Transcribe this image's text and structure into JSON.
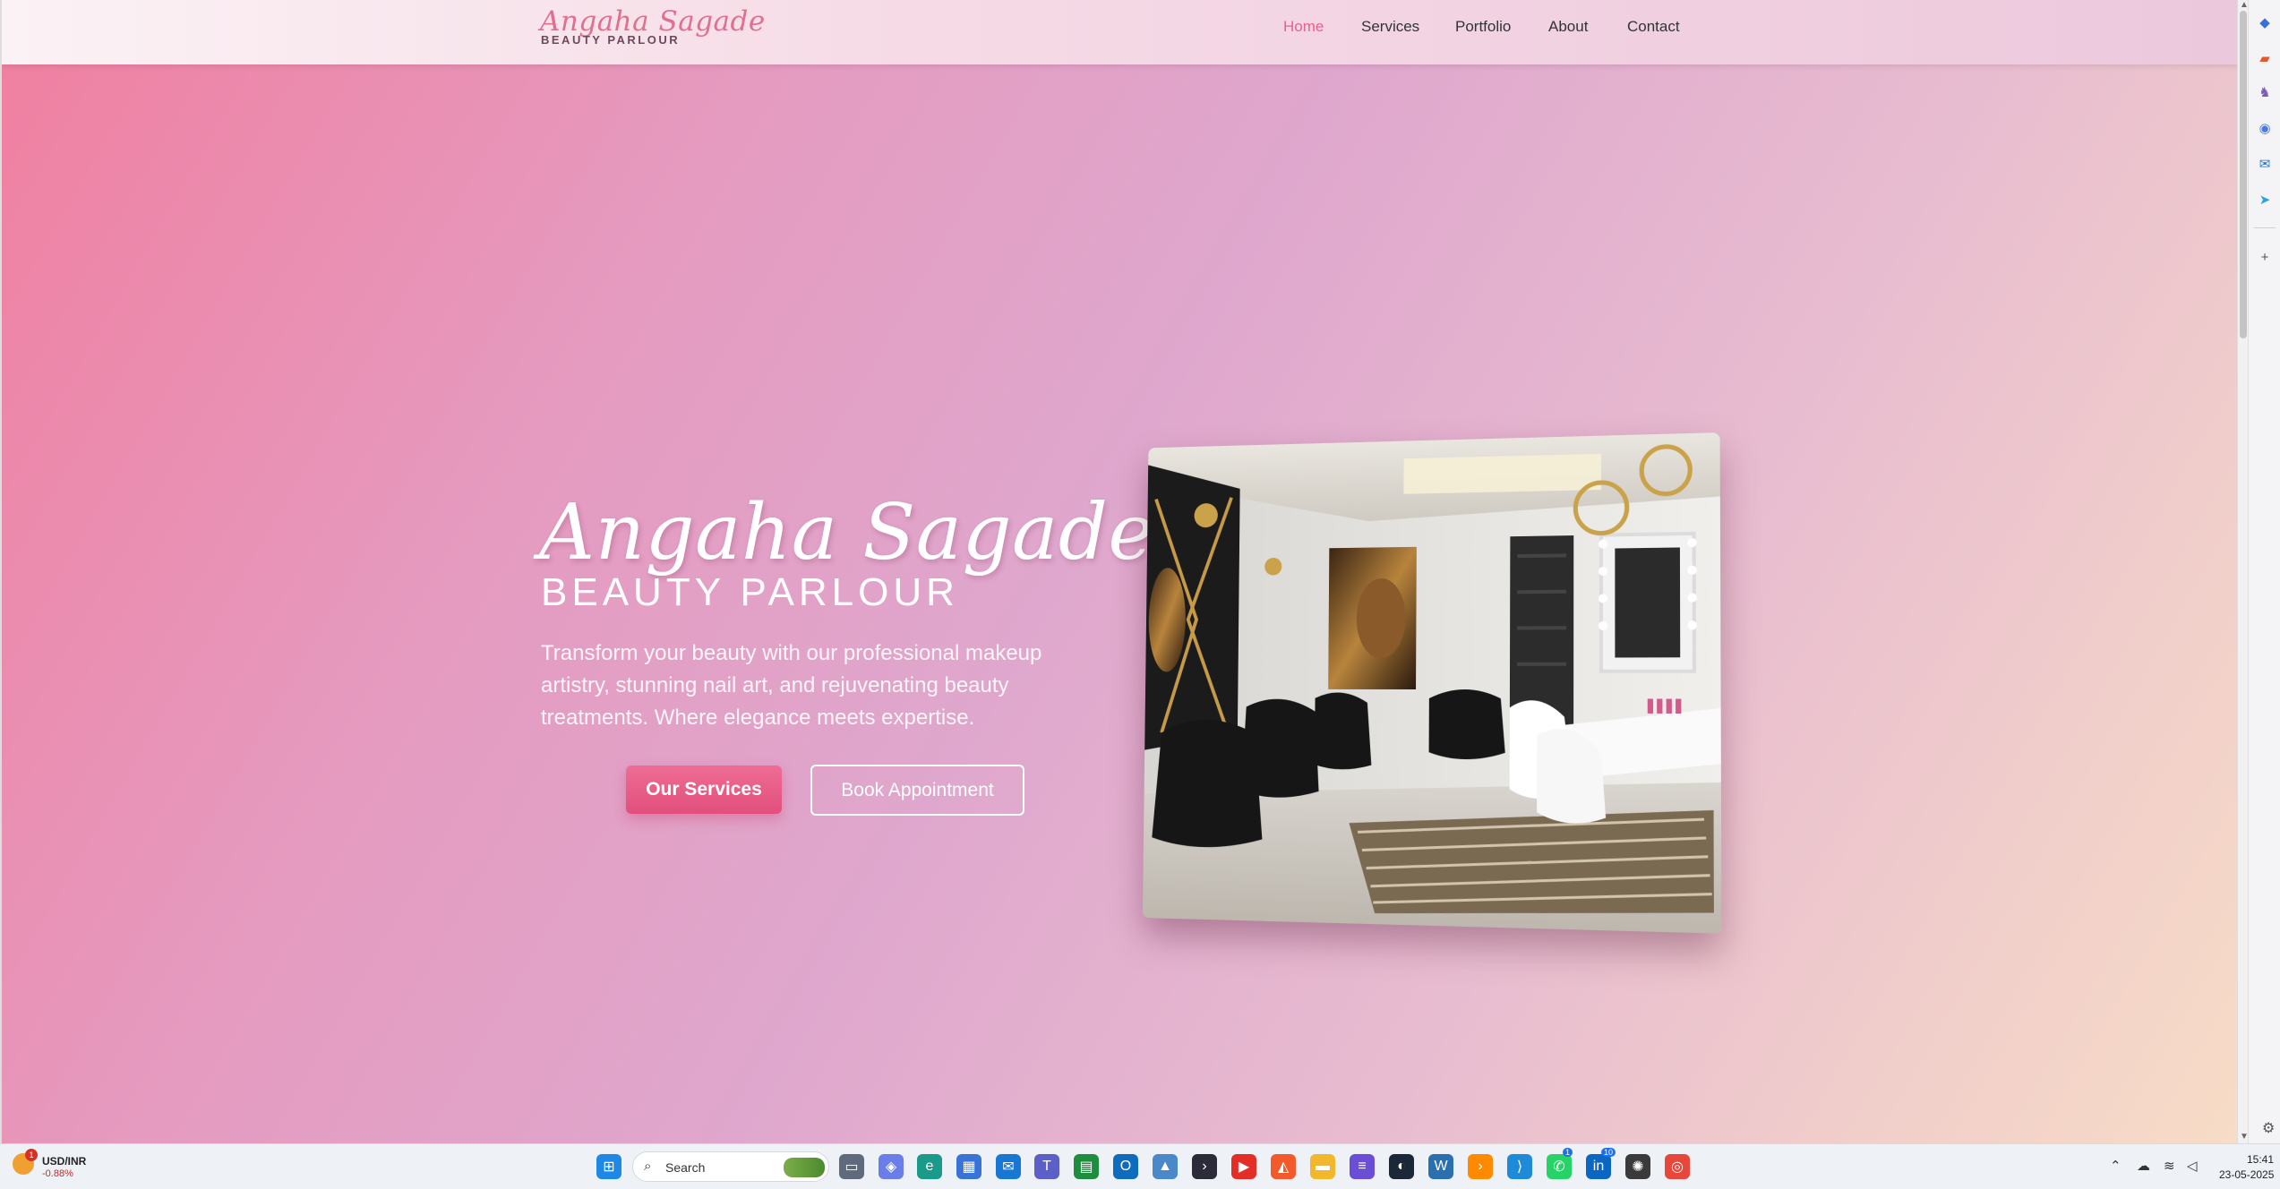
{
  "brand": {
    "name": "Angaha Sagade",
    "tagline": "BEAUTY PARLOUR"
  },
  "nav": {
    "items": [
      {
        "label": "Home",
        "active": true
      },
      {
        "label": "Services",
        "active": false
      },
      {
        "label": "Portfolio",
        "active": false
      },
      {
        "label": "About",
        "active": false
      },
      {
        "label": "Contact",
        "active": false
      }
    ]
  },
  "hero": {
    "title": "Angaha Sagade",
    "subtitle": "BEAUTY PARLOUR",
    "description": "Transform your beauty with our professional makeup artistry, stunning nail art, and rejuvenating beauty treatments. Where elegance meets expertise.",
    "primary_button": "Our Services",
    "secondary_button": "Book Appointment"
  },
  "colors": {
    "accent": "#e7628b",
    "gradient_start": "#f07fa0",
    "gradient_end": "#f7dcc6"
  },
  "taskbar": {
    "ticker_name": "USD/INR",
    "ticker_change": "-0.88%",
    "ticker_badge": "1",
    "search_placeholder": "Search",
    "whatsapp_badge": "1",
    "linkedin_badge": "10",
    "time": "15:41",
    "date": "23-05-2025"
  },
  "icons": {
    "edge_sidebar": [
      "copilot-icon",
      "shopping-icon",
      "games-icon",
      "m365-icon",
      "outlook-icon",
      "telegram-icon",
      "add-icon"
    ],
    "taskbar_apps": [
      "start-icon",
      "task-view-icon",
      "copilot-app-icon",
      "edge-icon",
      "store-icon",
      "mail-icon",
      "teams-icon",
      "sheets-icon",
      "outlook-app-icon",
      "photos-icon",
      "terminal-icon",
      "youtube-icon",
      "brave-icon",
      "file-explorer-icon",
      "notepad-icon",
      "steam-icon",
      "wordpress-icon",
      "sublime-icon",
      "vscode-icon",
      "whatsapp-icon",
      "linkedin-icon",
      "chatgpt-icon",
      "chrome-icon"
    ]
  }
}
